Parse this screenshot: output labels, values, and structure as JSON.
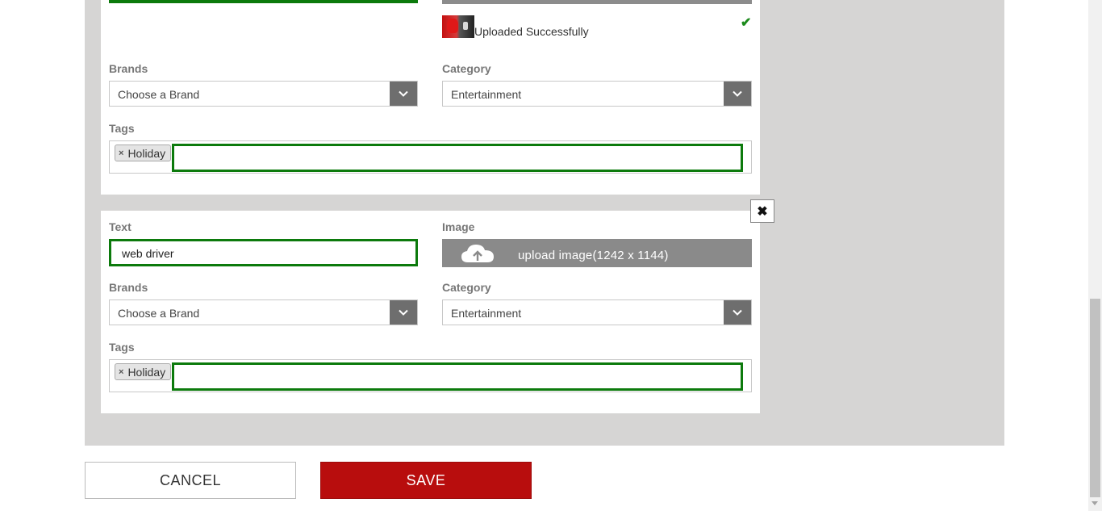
{
  "item1": {
    "upload_status": "Uploaded Successfully",
    "brands": {
      "label": "Brands",
      "selected": "Choose a Brand"
    },
    "category": {
      "label": "Category",
      "selected": "Entertainment"
    },
    "tags": {
      "label": "Tags",
      "chips": [
        "Holiday"
      ],
      "chip_remove": "×"
    }
  },
  "item2": {
    "text": {
      "label": "Text",
      "value": "web driver"
    },
    "image": {
      "label": "Image",
      "button_label": "upload image(1242 x 1144)"
    },
    "brands": {
      "label": "Brands",
      "selected": "Choose a Brand"
    },
    "category": {
      "label": "Category",
      "selected": "Entertainment"
    },
    "tags": {
      "label": "Tags",
      "chips": [
        "Holiday"
      ],
      "chip_remove": "×"
    },
    "close_label": "✖"
  },
  "actions": {
    "cancel_label": "CANCEL",
    "save_label": "SAVE"
  },
  "colors": {
    "accent_green": "#0c7a0c",
    "save_red": "#b80d0d",
    "panel_gray": "#d6d5d4",
    "upload_gray": "#8a8a8a"
  },
  "icons": {
    "check": "check-icon",
    "dropdown": "chevron-down-icon",
    "upload": "cloud-upload-icon",
    "close": "close-icon"
  }
}
